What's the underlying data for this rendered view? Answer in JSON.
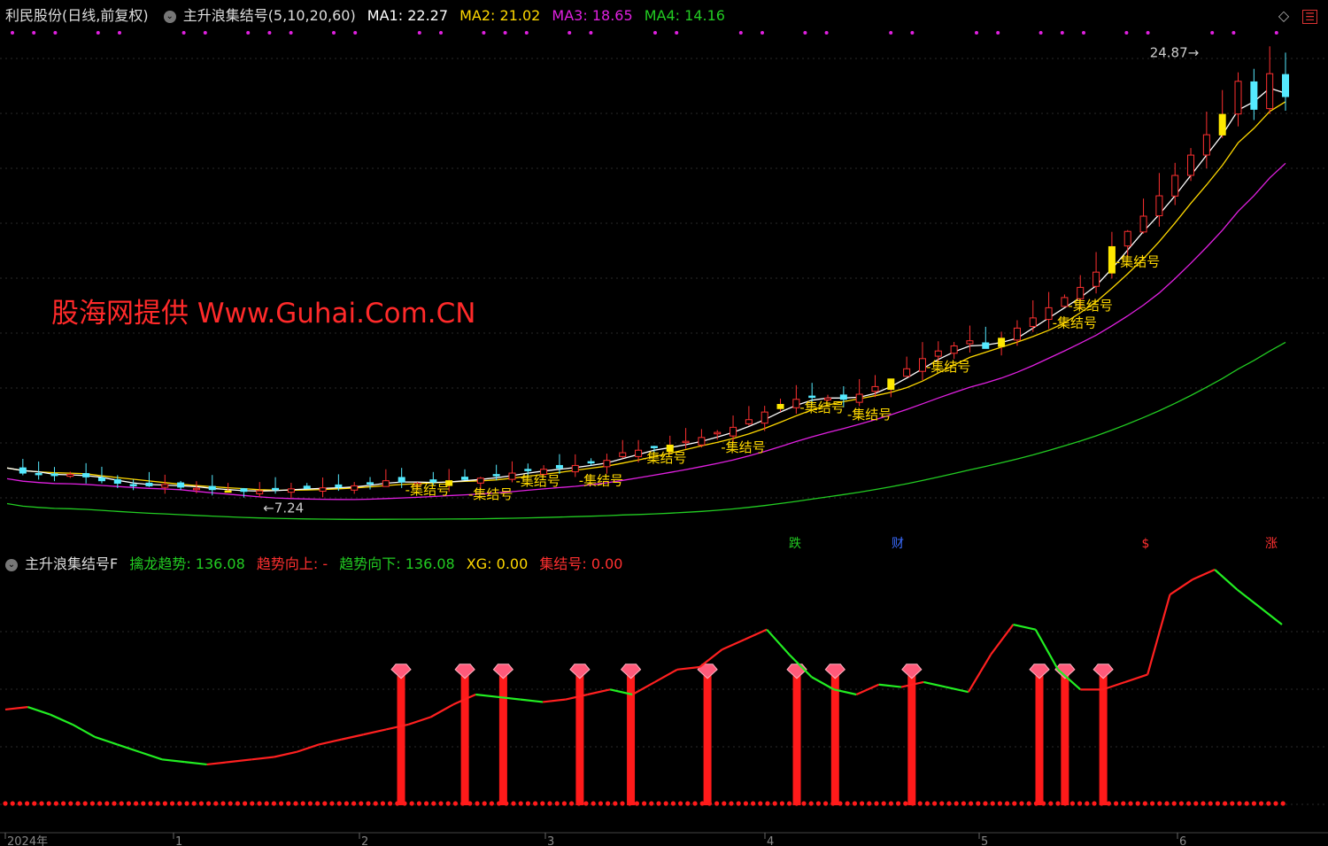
{
  "header": {
    "stock": "利民股份",
    "period": "(日线,前复权)",
    "indicator": "主升浪集结号(5,10,20,60)",
    "ma1": "MA1: 22.27",
    "ma2": "MA2: 21.02",
    "ma3": "MA3: 18.65",
    "ma4": "MA4: 14.16",
    "colors": {
      "ma1": "#ffffff",
      "ma2": "#ffd800",
      "ma3": "#e020e0",
      "ma4": "#22cc22"
    }
  },
  "watermark": "股海网提供 Www.Guhai.Com.CN",
  "annotations": {
    "high": "24.87",
    "low": "7.24",
    "signal": "集结号"
  },
  "event_markers": [
    "跌",
    "财",
    "$",
    "涨"
  ],
  "sub_header": {
    "indicator": "主升浪集结号F",
    "qinlong": "擒龙趋势: 136.08",
    "trend_up": "趋势向上: -",
    "trend_down": "趋势向下: 136.08",
    "xg": "XG: 0.00",
    "jijiehao": "集结号: 0.00"
  },
  "x_axis": [
    "2024年",
    "1",
    "2",
    "3",
    "4",
    "5",
    "6"
  ],
  "chart_data": [
    {
      "type": "candlestick",
      "title": "利民股份 (日线,前复权)",
      "price_range": [
        6.5,
        26
      ],
      "high": 24.87,
      "low": 7.24,
      "close_series": [
        8.3,
        8.1,
        8.05,
        8.0,
        8.05,
        7.95,
        7.8,
        7.7,
        7.65,
        7.6,
        7.65,
        7.55,
        7.5,
        7.45,
        7.4,
        7.38,
        7.4,
        7.45,
        7.48,
        7.5,
        7.52,
        7.55,
        7.6,
        7.7,
        7.8,
        7.75,
        7.7,
        7.75,
        7.8,
        7.85,
        7.9,
        8.0,
        8.1,
        8.2,
        8.25,
        8.3,
        8.4,
        8.5,
        8.6,
        8.9,
        9.0,
        9.1,
        9.2,
        9.35,
        9.5,
        9.7,
        9.9,
        10.2,
        10.5,
        10.8,
        11.0,
        11.1,
        11.05,
        11.0,
        11.2,
        11.5,
        11.8,
        12.2,
        12.6,
        12.9,
        13.1,
        13.3,
        13.0,
        13.4,
        13.8,
        14.2,
        14.6,
        15.0,
        15.4,
        16.0,
        17.0,
        17.6,
        18.2,
        19.0,
        19.8,
        20.6,
        21.4,
        22.2,
        23.5,
        22.4,
        23.8,
        22.9
      ],
      "ma_values": {
        "MA1": 22.27,
        "MA2": 21.02,
        "MA3": 18.65,
        "MA4": 14.16
      }
    },
    {
      "type": "line",
      "title": "主升浪集结号F",
      "ylim": [
        0,
        1
      ],
      "trend": [
        0.44,
        0.45,
        0.42,
        0.38,
        0.33,
        0.3,
        0.27,
        0.24,
        0.23,
        0.22,
        0.23,
        0.24,
        0.25,
        0.27,
        0.3,
        0.32,
        0.34,
        0.36,
        0.38,
        0.41,
        0.46,
        0.5,
        0.49,
        0.48,
        0.47,
        0.48,
        0.5,
        0.52,
        0.5,
        0.55,
        0.6,
        0.61,
        0.68,
        0.72,
        0.76,
        0.66,
        0.57,
        0.52,
        0.5,
        0.54,
        0.53,
        0.55,
        0.53,
        0.51,
        0.66,
        0.78,
        0.76,
        0.6,
        0.52,
        0.52,
        0.55,
        0.58,
        0.9,
        0.96,
        1.0,
        0.92,
        0.85,
        0.78
      ],
      "signal_days": [
        0.31,
        0.36,
        0.39,
        0.45,
        0.49,
        0.55,
        0.62,
        0.65,
        0.71,
        0.81,
        0.83,
        0.86
      ],
      "signal_value": 0.6
    }
  ]
}
